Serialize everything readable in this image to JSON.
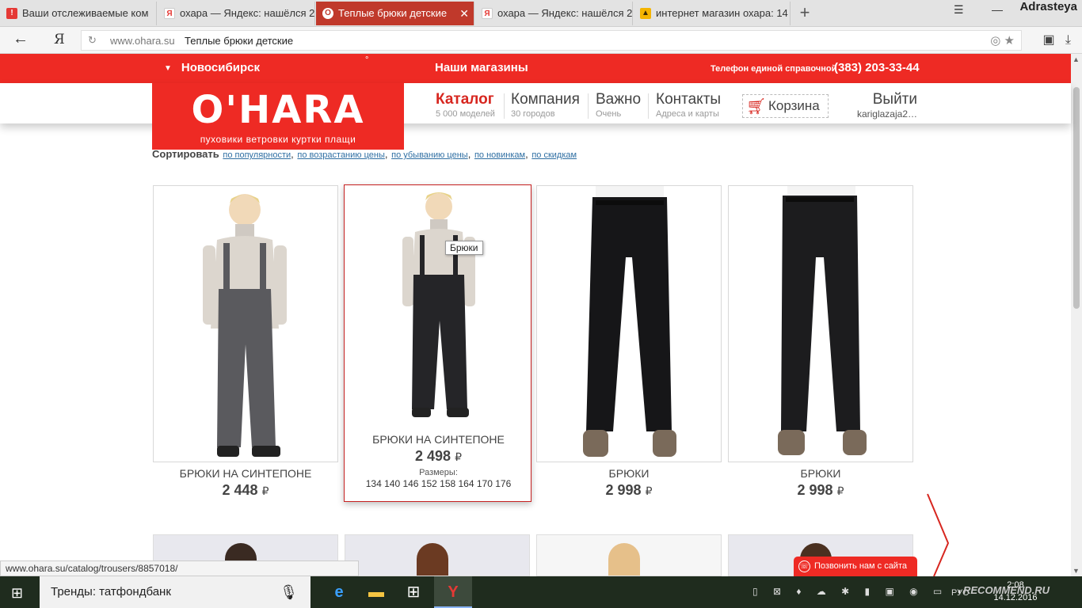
{
  "browser": {
    "tabs": [
      {
        "label": "Ваши отслеживаемые ком",
        "favicon": "red-pin",
        "active": false
      },
      {
        "label": "охара — Яндекс: нашёлся 2",
        "favicon": "yandex",
        "active": false
      },
      {
        "label": "Теплые брюки детские",
        "favicon": "ohara",
        "active": true
      },
      {
        "label": "охара — Яндекс: нашёлся 2",
        "favicon": "yandex",
        "active": false
      },
      {
        "label": "интернет магазин охара: 14",
        "favicon": "landscape",
        "active": false
      }
    ],
    "user_overlay": "Adrasteya",
    "address": {
      "domain": "www.ohara.su",
      "page_title": "Теплые брюки детские"
    },
    "status_url": "www.ohara.su/catalog/trousers/8857018/"
  },
  "site": {
    "city": "Новосибирск",
    "stores": "Наши магазины",
    "phone_label": "Телефон единой справочной",
    "phone": "(383) 203-33-44",
    "logo_word": "O'HARA",
    "logo_tagline": "пуховики ветровки куртки плащи",
    "nav": [
      {
        "main": "Каталог",
        "sub": "5 000 моделей"
      },
      {
        "main": "Компания",
        "sub": "30 городов"
      },
      {
        "main": "Важно",
        "sub": "Очень"
      },
      {
        "main": "Контакты",
        "sub": "Адреса и карты"
      }
    ],
    "cart_label": "Корзина",
    "logout_label": "Выйти",
    "username": "kariglazaja2…",
    "sort_label": "Сортировать",
    "sort_options": [
      "по популярности",
      "по возрастанию цены",
      "по убыванию цены",
      "по новинкам",
      "по скидкам"
    ],
    "tooltip": "Брюки",
    "callback": "Позвонить нам с сайта",
    "accent_color": "#ee2a24"
  },
  "products": [
    {
      "name": "БРЮКИ НА СИНТЕПОНЕ",
      "price": "2 448",
      "currency": "₽",
      "pants_color": "#5a5a5e"
    },
    {
      "name": "БРЮКИ НА СИНТЕПОНЕ",
      "price": "2 498",
      "currency": "₽",
      "sizes_label": "Размеры:",
      "sizes": "134 140 146 152 158 164 170 176",
      "pants_color": "#252528"
    },
    {
      "name": "БРЮКИ",
      "price": "2 998",
      "currency": "₽",
      "pants_color": "#161618"
    },
    {
      "name": "БРЮКИ",
      "price": "2 998",
      "currency": "₽",
      "pants_color": "#1c1c1e"
    }
  ],
  "taskbar": {
    "search_text": "Тренды: татфондбанк",
    "lang": "РУС",
    "time": "2:08",
    "date": "14.12.2016",
    "watermark": "RECOMMEND.RU"
  }
}
